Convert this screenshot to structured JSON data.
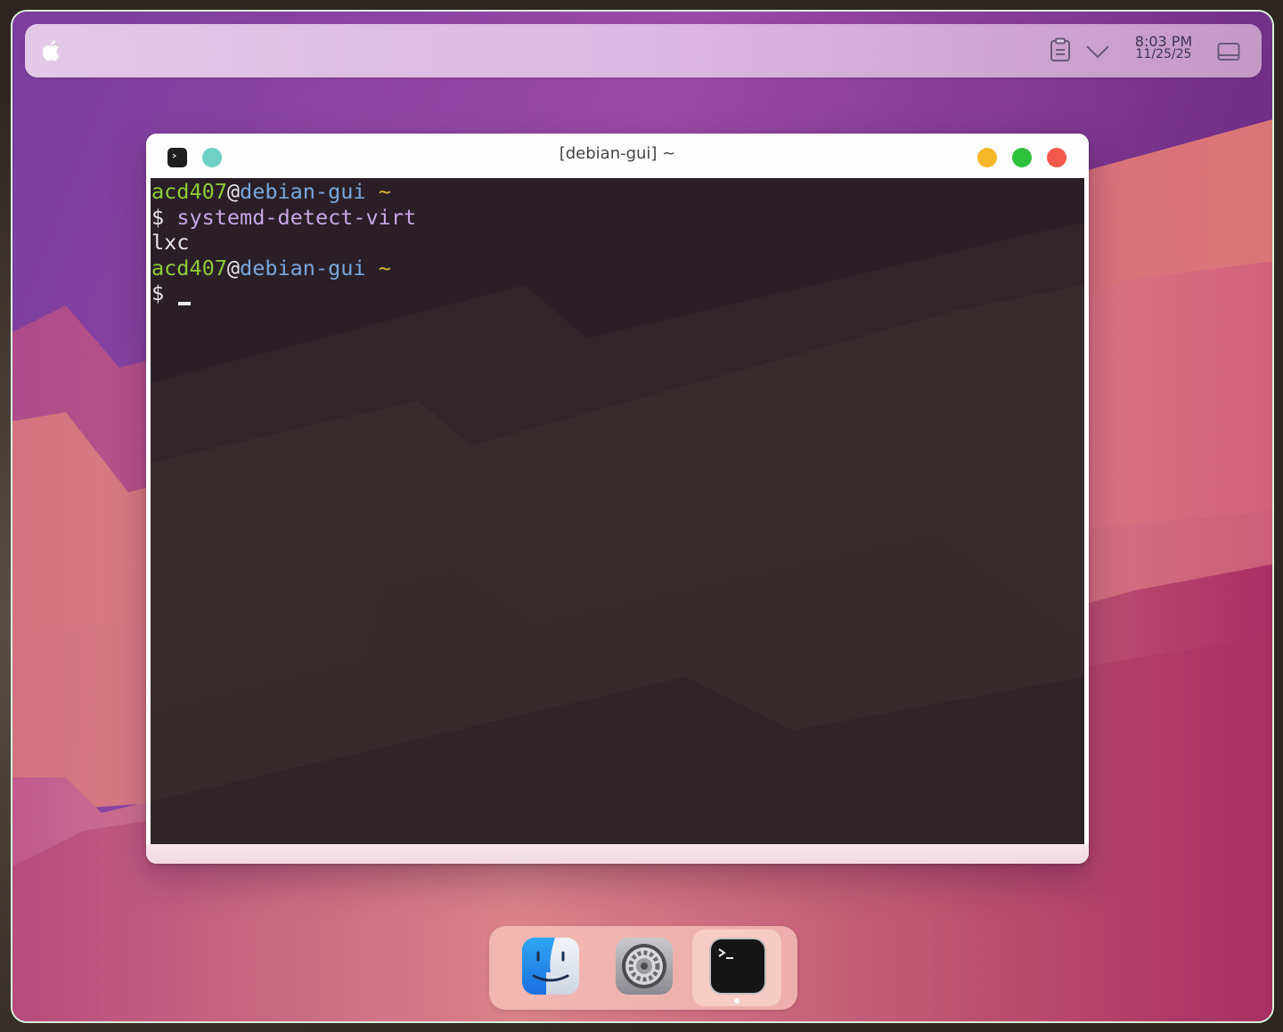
{
  "menubar": {
    "apple_icon": "apple-icon",
    "clipboard_icon": "clipboard-icon",
    "chevron_icon": "chevron-down-icon",
    "time": "8:03 PM",
    "date": "11/25/25",
    "screen_icon": "window-icon"
  },
  "window": {
    "title": "[debian-gui] ~",
    "buttons": {
      "minimize_color": "#f5b82a",
      "maximize_color": "#2ec23c",
      "close_color": "#f2594b",
      "pin_color": "#6fd0c4"
    },
    "terminal": {
      "user": "acd407",
      "at": "@",
      "host": "debian-gui",
      "tilde": "~",
      "prompt": "$",
      "command": "systemd-detect-virt",
      "output": "lxc"
    }
  },
  "dock": {
    "items": [
      {
        "name": "Finder",
        "icon": "finder-icon"
      },
      {
        "name": "System Settings",
        "icon": "settings-gear-icon"
      },
      {
        "name": "Terminal",
        "icon": "terminal-icon",
        "active": true
      }
    ]
  },
  "colors": {
    "user": "#8ecb3a",
    "host": "#7aa7dc",
    "tilde": "#d7b83c",
    "command": "#c9a6e6",
    "terminal_bg": "#2b2226"
  }
}
